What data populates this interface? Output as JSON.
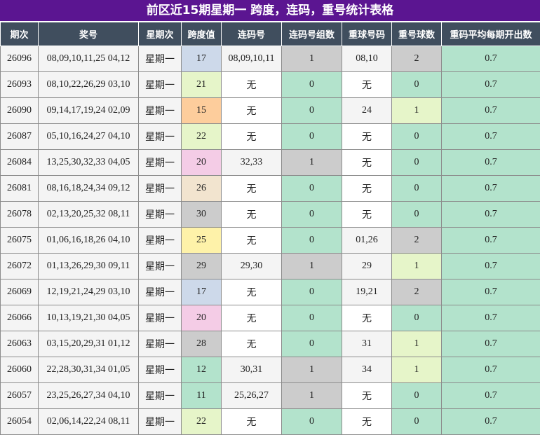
{
  "title": "前区近15期星期一 跨度，连码，重号统计表格",
  "headers": [
    "期次",
    "奖号",
    "星期次",
    "跨度值",
    "连码号",
    "连码号组数",
    "重球号码",
    "重号球数",
    "重码平均每期开出数"
  ],
  "rows": [
    {
      "issue": "26096",
      "numbers": "08,09,10,11,25 04,12",
      "weekday": "星期一",
      "span": "17",
      "span_color": "#cdd9ea",
      "consec": "08,09,10,11",
      "groups": "1",
      "groups_color": "#cccccc",
      "repeat": "08,10",
      "repeat_count": "2",
      "count_color": "#cccccc",
      "avg": "0.7"
    },
    {
      "issue": "26093",
      "numbers": "08,10,22,26,29 03,10",
      "weekday": "星期一",
      "span": "21",
      "span_color": "#e6f5c9",
      "consec": "无",
      "groups": "0",
      "groups_color": "#b3e3cc",
      "repeat": "无",
      "repeat_count": "0",
      "count_color": "#b3e3cc",
      "avg": "0.7"
    },
    {
      "issue": "26090",
      "numbers": "09,14,17,19,24 02,09",
      "weekday": "星期一",
      "span": "15",
      "span_color": "#fdcd9c",
      "consec": "无",
      "groups": "0",
      "groups_color": "#b3e3cc",
      "repeat": "24",
      "repeat_count": "1",
      "count_color": "#e6f5c9",
      "avg": "0.7"
    },
    {
      "issue": "26087",
      "numbers": "05,10,16,24,27 04,10",
      "weekday": "星期一",
      "span": "22",
      "span_color": "#e6f5c9",
      "consec": "无",
      "groups": "0",
      "groups_color": "#b3e3cc",
      "repeat": "无",
      "repeat_count": "0",
      "count_color": "#b3e3cc",
      "avg": "0.7"
    },
    {
      "issue": "26084",
      "numbers": "13,25,30,32,33 04,05",
      "weekday": "星期一",
      "span": "20",
      "span_color": "#f4cce6",
      "consec": "32,33",
      "groups": "1",
      "groups_color": "#cccccc",
      "repeat": "无",
      "repeat_count": "0",
      "count_color": "#b3e3cc",
      "avg": "0.7"
    },
    {
      "issue": "26081",
      "numbers": "08,16,18,24,34 09,12",
      "weekday": "星期一",
      "span": "26",
      "span_color": "#f2e4cf",
      "consec": "无",
      "groups": "0",
      "groups_color": "#b3e3cc",
      "repeat": "无",
      "repeat_count": "0",
      "count_color": "#b3e3cc",
      "avg": "0.7"
    },
    {
      "issue": "26078",
      "numbers": "02,13,20,25,32 08,11",
      "weekday": "星期一",
      "span": "30",
      "span_color": "#cccccc",
      "consec": "无",
      "groups": "0",
      "groups_color": "#b3e3cc",
      "repeat": "无",
      "repeat_count": "0",
      "count_color": "#b3e3cc",
      "avg": "0.7"
    },
    {
      "issue": "26075",
      "numbers": "01,06,16,18,26 04,10",
      "weekday": "星期一",
      "span": "25",
      "span_color": "#fef2a9",
      "consec": "无",
      "groups": "0",
      "groups_color": "#b3e3cc",
      "repeat": "01,26",
      "repeat_count": "2",
      "count_color": "#cccccc",
      "avg": "0.7"
    },
    {
      "issue": "26072",
      "numbers": "01,13,26,29,30 09,11",
      "weekday": "星期一",
      "span": "29",
      "span_color": "#cccccc",
      "consec": "29,30",
      "groups": "1",
      "groups_color": "#cccccc",
      "repeat": "29",
      "repeat_count": "1",
      "count_color": "#e6f5c9",
      "avg": "0.7"
    },
    {
      "issue": "26069",
      "numbers": "12,19,21,24,29 03,10",
      "weekday": "星期一",
      "span": "17",
      "span_color": "#cdd9ea",
      "consec": "无",
      "groups": "0",
      "groups_color": "#b3e3cc",
      "repeat": "19,21",
      "repeat_count": "2",
      "count_color": "#cccccc",
      "avg": "0.7"
    },
    {
      "issue": "26066",
      "numbers": "10,13,19,21,30 04,05",
      "weekday": "星期一",
      "span": "20",
      "span_color": "#f4cce6",
      "consec": "无",
      "groups": "0",
      "groups_color": "#b3e3cc",
      "repeat": "无",
      "repeat_count": "0",
      "count_color": "#b3e3cc",
      "avg": "0.7"
    },
    {
      "issue": "26063",
      "numbers": "03,15,20,29,31 01,12",
      "weekday": "星期一",
      "span": "28",
      "span_color": "#cccccc",
      "consec": "无",
      "groups": "0",
      "groups_color": "#b3e3cc",
      "repeat": "31",
      "repeat_count": "1",
      "count_color": "#e6f5c9",
      "avg": "0.7"
    },
    {
      "issue": "26060",
      "numbers": "22,28,30,31,34 01,05",
      "weekday": "星期一",
      "span": "12",
      "span_color": "#b3e3cc",
      "consec": "30,31",
      "groups": "1",
      "groups_color": "#cccccc",
      "repeat": "34",
      "repeat_count": "1",
      "count_color": "#e6f5c9",
      "avg": "0.7"
    },
    {
      "issue": "26057",
      "numbers": "23,25,26,27,34 04,10",
      "weekday": "星期一",
      "span": "11",
      "span_color": "#b3e3cc",
      "consec": "25,26,27",
      "groups": "1",
      "groups_color": "#cccccc",
      "repeat": "无",
      "repeat_count": "0",
      "count_color": "#b3e3cc",
      "avg": "0.7"
    },
    {
      "issue": "26054",
      "numbers": "02,06,14,22,24 08,11",
      "weekday": "星期一",
      "span": "22",
      "span_color": "#e6f5c9",
      "consec": "无",
      "groups": "0",
      "groups_color": "#b3e3cc",
      "repeat": "无",
      "repeat_count": "0",
      "count_color": "#b3e3cc",
      "avg": "0.7"
    }
  ],
  "colors": {
    "title_bg": "#5b1591",
    "header_bg": "#404e5e",
    "avg_bg": "#b3e3cc",
    "cell_bg": "#f4f4f4"
  }
}
